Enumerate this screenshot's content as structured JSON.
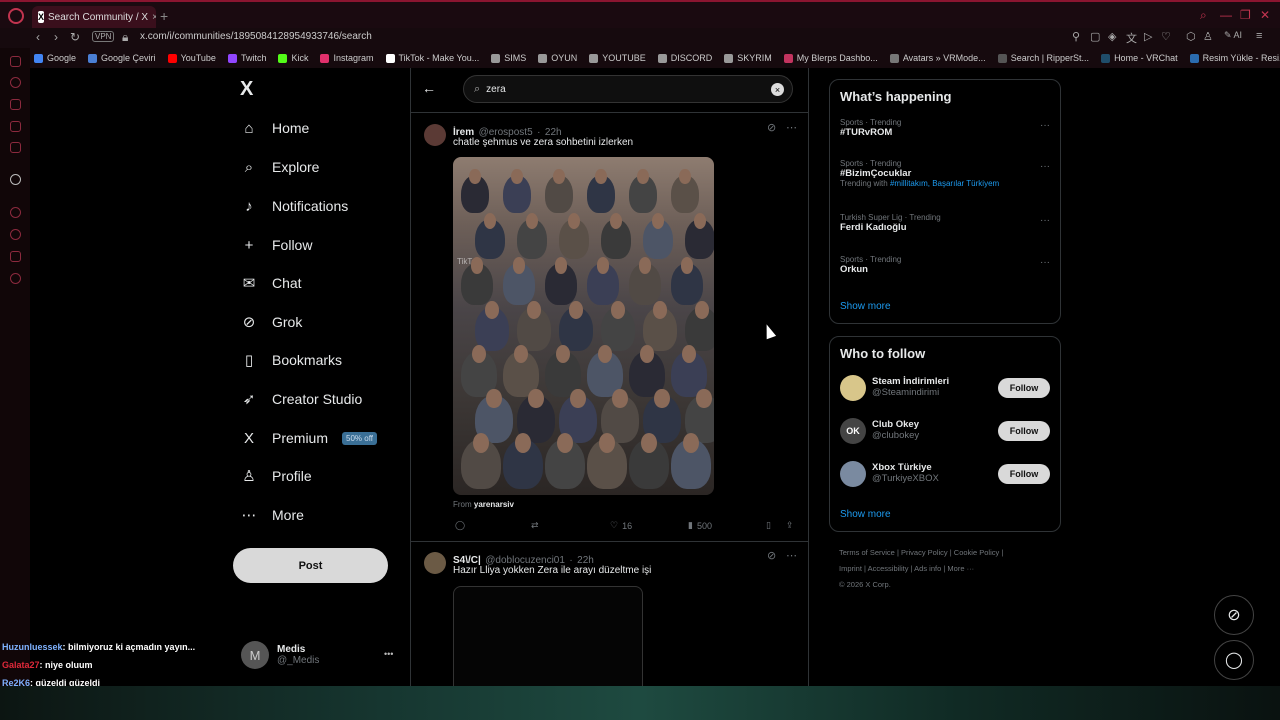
{
  "browser": {
    "tab_title": "Search Community / X",
    "tab_icon": "X",
    "new_tab": "+",
    "vpn_label": "VPN",
    "url": "x.com/i/communities/1895084128954933746/search",
    "toolbar_ai": "AI",
    "bookmarks": [
      {
        "label": "Google",
        "color": "#4285f4"
      },
      {
        "label": "Google Çeviri",
        "color": "#4a7fd4"
      },
      {
        "label": "YouTube",
        "color": "#ff0000"
      },
      {
        "label": "Twitch",
        "color": "#9146ff"
      },
      {
        "label": "Kick",
        "color": "#53fc18"
      },
      {
        "label": "Instagram",
        "color": "#e1306c"
      },
      {
        "label": "TikTok - Make You...",
        "color": "#ffffff"
      },
      {
        "label": "SIMS",
        "color": "#999999"
      },
      {
        "label": "OYUN",
        "color": "#999999"
      },
      {
        "label": "YOUTUBE",
        "color": "#999999"
      },
      {
        "label": "DISCORD",
        "color": "#999999"
      },
      {
        "label": "SKYRIM",
        "color": "#999999"
      },
      {
        "label": "My Blerps Dashbo...",
        "color": "#c2345f"
      },
      {
        "label": "Avatars » VRMode...",
        "color": "#777777"
      },
      {
        "label": "Search | RipperSt...",
        "color": "#555555"
      },
      {
        "label": "Home - VRChat",
        "color": "#1f4d6a"
      },
      {
        "label": "Resim Yükle - Resi...",
        "color": "#2b6cb0"
      }
    ],
    "bookmarks_more": "»"
  },
  "nav": {
    "logo": "X",
    "items": [
      {
        "label": "Home",
        "icon": "⌂"
      },
      {
        "label": "Explore",
        "icon": "⌕"
      },
      {
        "label": "Notifications",
        "icon": "♪"
      },
      {
        "label": "Follow",
        "icon": "+"
      },
      {
        "label": "Chat",
        "icon": "✉"
      },
      {
        "label": "Grok",
        "icon": "⊘"
      },
      {
        "label": "Bookmarks",
        "icon": "▯"
      },
      {
        "label": "Creator Studio",
        "icon": "➶"
      },
      {
        "label": "Premium",
        "icon": "X"
      },
      {
        "label": "Profile",
        "icon": "♙"
      },
      {
        "label": "More",
        "icon": "⋯"
      }
    ],
    "premium_badge": "50% off",
    "post_button": "Post",
    "account_name": "Medis",
    "account_handle": "@_Medis",
    "account_initial": "M",
    "account_more": "•••"
  },
  "search": {
    "back": "←",
    "query": "zera",
    "clear": "×"
  },
  "tweets": [
    {
      "name": "İrem",
      "handle": "@erospost5",
      "time": "22h",
      "text": "chatle şehmus ve zera sohbetini izlerken",
      "media_source_prefix": "From",
      "media_source": "yarenarsiv",
      "watermark": "TikTok",
      "likes": "16",
      "views": "500"
    },
    {
      "name": "S4\\/C|",
      "handle": "@doblocuzenci01",
      "time": "22h",
      "text": "Hazır Lliya yokken Zera ile arayı düzeltme işi"
    }
  ],
  "whats_happening": {
    "title": "What’s happening",
    "trends": [
      {
        "category": "Sports · Trending",
        "name": "#TURvROM",
        "extra": ""
      },
      {
        "category": "Sports · Trending",
        "name": "#BizimÇocuklar",
        "extra_prefix": "Trending with",
        "extra": "#millitakım, Başarılar Türkiyem"
      },
      {
        "category": "Turkish Super Lig · Trending",
        "name": "Ferdi Kadıoğlu",
        "extra": ""
      },
      {
        "category": "Sports · Trending",
        "name": "Orkun",
        "extra": ""
      }
    ],
    "show_more": "Show more"
  },
  "who_to_follow": {
    "title": "Who to follow",
    "accounts": [
      {
        "name": "Steam İndirimleri",
        "handle": "@Steamindirimi",
        "button": "Follow",
        "avatar_text": "",
        "color": "#d8c68a"
      },
      {
        "name": "Club Okey",
        "handle": "@clubokey",
        "button": "Follow",
        "avatar_text": "OK",
        "color": "#444444"
      },
      {
        "name": "Xbox Türkiye",
        "handle": "@TurkiyeXBOX",
        "button": "Follow",
        "avatar_text": "",
        "color": "#7a8aa0"
      }
    ],
    "show_more": "Show more"
  },
  "footer": {
    "links": [
      "Terms of Service",
      "Privacy Policy",
      "Cookie Policy",
      "Imprint",
      "Accessibility",
      "Ads info",
      "More ···"
    ],
    "copyright": "© 2026 X Corp."
  },
  "stream_chat": [
    {
      "user": "Huzunluessek",
      "message": ": bilmiyoruz ki açmadın yayın...",
      "color": "#7fb2ff"
    },
    {
      "user": "Galata27",
      "message": ": niye oluum",
      "color": "#e0293a"
    },
    {
      "user": "Re2K6",
      "message": ": güzeldi güzeldi",
      "color": "#7fb2ff"
    }
  ],
  "colors": {
    "accent": "#1d9bf0",
    "premium_badge": "#3a6f96",
    "opera_red": "#c2344f"
  }
}
